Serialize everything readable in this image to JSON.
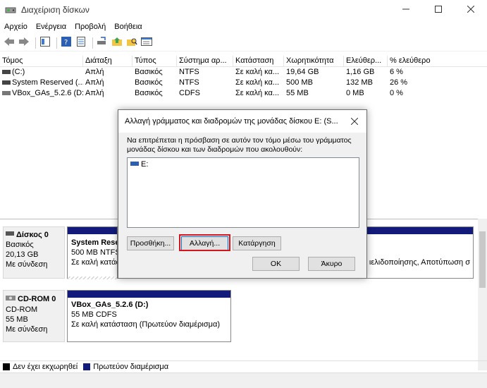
{
  "window": {
    "title": "Διαχείριση δίσκων",
    "icons": {
      "app": "disk-management-icon",
      "minimize": "minimize-icon",
      "maximize": "maximize-icon",
      "close": "close-icon"
    }
  },
  "menu": [
    "Αρχείο",
    "Ενέργεια",
    "Προβολή",
    "Βοήθεια"
  ],
  "table": {
    "headers": [
      "Τόμος",
      "Διάταξη",
      "Τύπος",
      "Σύστημα αρ...",
      "Κατάσταση",
      "Χωρητικότητα",
      "Ελεύθερ...",
      "% ελεύθερο"
    ],
    "rows": [
      [
        "(C:)",
        "Απλή",
        "Βασικός",
        "NTFS",
        "Σε καλή κα...",
        "19,64 GB",
        "1,16 GB",
        "6 %"
      ],
      [
        "System Reserved (...",
        "Απλή",
        "Βασικός",
        "NTFS",
        "Σε καλή κα...",
        "500 MB",
        "132 MB",
        "26 %"
      ],
      [
        "VBox_GAs_5.2.6 (D:)",
        "Απλή",
        "Βασικός",
        "CDFS",
        "Σε καλή κα...",
        "55 MB",
        "0 MB",
        "0 %"
      ]
    ]
  },
  "disks": {
    "disk0": {
      "name": "Δίσκος 0",
      "type": "Βασικός",
      "size": "20,13 GB",
      "status": "Με σύνδεση",
      "part1": {
        "name": "System Rese",
        "size": "500 MB NTFS",
        "status": "Σε καλή κατάσ"
      },
      "part2": {
        "status_tail": "ιελιδοποίησης, Αποτύπωση σ"
      }
    },
    "cdrom0": {
      "name": "CD-ROM 0",
      "type": "CD-ROM",
      "size": "55 MB",
      "status": "Με σύνδεση",
      "part": {
        "name": "VBox_GAs_5.2.6  (D:)",
        "size": "55 MB CDFS",
        "status": "Σε καλή κατάσταση (Πρωτεύον διαμέρισμα)"
      }
    }
  },
  "legend": [
    {
      "label": "Δεν έχει εκχωρηθεί",
      "color": "#000000"
    },
    {
      "label": "Πρωτεύον διαμέρισμα",
      "color": "#121b7a"
    }
  ],
  "dialog": {
    "title": "Αλλαγή γράμματος και διαδρομών της μονάδας δίσκου E: (S...",
    "description": "Να επιτρέπεται η πρόσβαση σε αυτόν τον τόμο μέσω του γράμματος μονάδας δίσκου και των διαδρομών που ακολουθούν:",
    "list_items": [
      "E:"
    ],
    "buttons": {
      "add": "Προσθήκη...",
      "change": "Αλλαγή...",
      "remove": "Κατάργηση",
      "ok": "OK",
      "cancel": "Άκυρο"
    }
  },
  "colors": {
    "primary_partition": "#121b7a",
    "highlight": "#d6141b",
    "focus": "#0078d7"
  }
}
